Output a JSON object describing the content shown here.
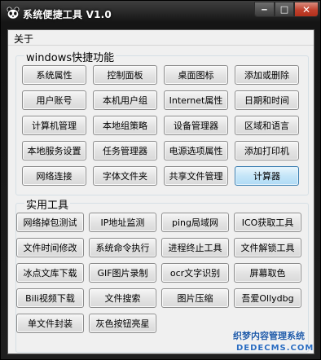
{
  "window": {
    "title": "系统便捷工具 V1.0",
    "min_glyph": "‒",
    "max_glyph": "□",
    "close_glyph": "✕",
    "app_icon": "panda-icon"
  },
  "menu": {
    "about": "关于"
  },
  "windows_group": {
    "title": "windows快捷功能",
    "buttons": [
      "系统属性",
      "控制面板",
      "桌面图标",
      "添加或删除",
      "用户账号",
      "本机用户组",
      "Internet属性",
      "日期和时间",
      "计算机管理",
      "本地组策略",
      "设备管理器",
      "区域和语言",
      "本地服务设置",
      "任务管理器",
      "电源选项属性",
      "添加打印机",
      "网络连接",
      "字体文件夹",
      "共享文件管理",
      "计算器"
    ]
  },
  "tools_group": {
    "title": "实用工具",
    "buttons": [
      "网络掉包测试",
      "IP地址监测",
      "ping局域网",
      "ICO获取工具",
      "文件时间修改",
      "系统命令执行",
      "进程终止工具",
      "文件解锁工具",
      "冰点文库下载",
      "GIF图片录制",
      "ocr文字识别",
      "屏幕取色",
      "Bili视频下载",
      "文件搜索",
      "图片压缩",
      "吾爱Ollydbg",
      "单文件封装",
      "灰色按钮亮星"
    ]
  },
  "watermark": {
    "line1": "织梦内容管理系统",
    "line2": "DEDECMS.COM"
  },
  "colors": {
    "title_bar": "#1e1e1e",
    "client_bg": "#f0f0f0",
    "focused_button": "#b0dbf5",
    "close_button": "#c0402c",
    "watermark": "#1f5aa8"
  }
}
